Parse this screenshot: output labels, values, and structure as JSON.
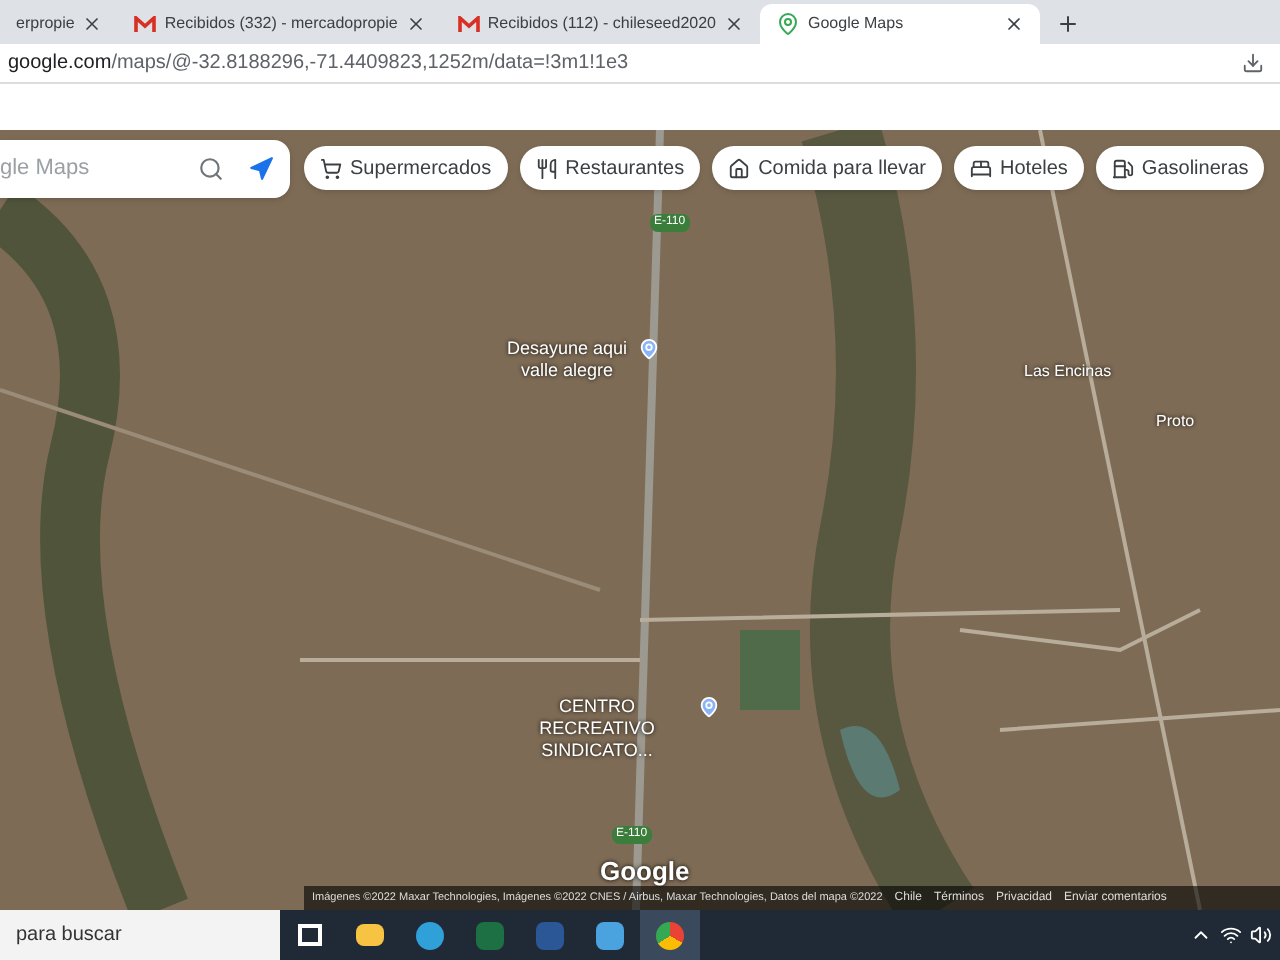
{
  "tabs": [
    {
      "title": "erpropie",
      "selected": false,
      "kind": "plain"
    },
    {
      "title": "Recibidos (332) - mercadopropie",
      "selected": false,
      "kind": "mail"
    },
    {
      "title": "Recibidos (112) - chileseed2020",
      "selected": false,
      "kind": "mail"
    },
    {
      "title": "Google Maps",
      "selected": true,
      "kind": "maps"
    }
  ],
  "address_bar": {
    "domain": "google.com",
    "path": "/maps/@-32.8188296,-71.4409823,1252m/data=!3m1!1e3"
  },
  "search": {
    "placeholder": "gle Maps"
  },
  "chips": [
    {
      "label": "Supermercados",
      "kind": "cart"
    },
    {
      "label": "Restaurantes",
      "kind": "food"
    },
    {
      "label": "Comida para llevar",
      "kind": "takeout"
    },
    {
      "label": "Hoteles",
      "kind": "bed"
    },
    {
      "label": "Gasolineras",
      "kind": "fuel"
    }
  ],
  "map_labels": [
    {
      "text": "Desayune aqui valle alegre",
      "kind": "place"
    },
    {
      "text": "CENTRO RECREATIVO SINDICATO...",
      "kind": "place"
    },
    {
      "text": "Las Encinas",
      "kind": "road"
    },
    {
      "text": "Proto",
      "kind": "road"
    },
    {
      "text": "E-110",
      "kind": "highway"
    },
    {
      "text": "E-110",
      "kind": "highway"
    }
  ],
  "logo": "Google",
  "attribution": {
    "credits": "Imágenes ©2022 Maxar Technologies, Imágenes ©2022 CNES / Airbus, Maxar Technologies, Datos del mapa ©2022",
    "links": [
      "Chile",
      "Términos",
      "Privacidad",
      "Enviar comentarios"
    ]
  },
  "taskbar": {
    "search_text": "para buscar",
    "apps": [
      {
        "kind": "taskview",
        "active": false
      },
      {
        "kind": "folder",
        "active": false
      },
      {
        "kind": "edge",
        "active": false
      },
      {
        "kind": "excel",
        "active": false
      },
      {
        "kind": "word",
        "active": false
      },
      {
        "kind": "photos",
        "active": false
      },
      {
        "kind": "chrome",
        "active": true
      }
    ]
  }
}
